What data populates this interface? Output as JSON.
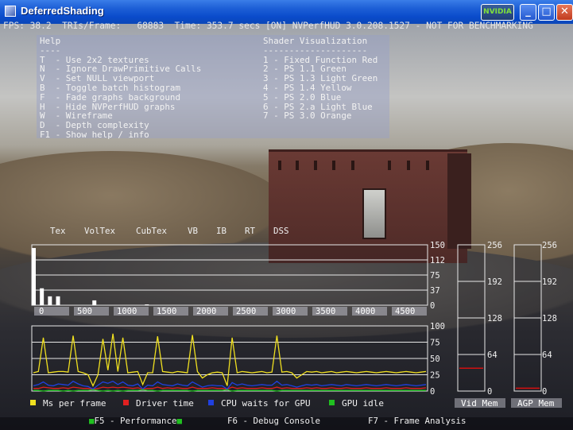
{
  "window": {
    "title": "DeferredShading",
    "nvidia_button": "NVIDIA",
    "minimize_glyph": "_",
    "maximize_glyph": "□",
    "close_glyph": "✕"
  },
  "status_line": "FPS: 38.2  TRIs/Frame:   68883  Time: 353.7 secs [ON] NVPerfHUD 3.0.208.1527 - NOT FOR BENCHMARKING",
  "help": {
    "title": "Help",
    "underline": "----",
    "items": [
      "T  - Use 2x2 textures",
      "N  - Ignore DrawPrimitive Calls",
      "V  - Set NULL viewport",
      "B  - Toggle batch histogram",
      "F  - Fade graphs background",
      "H  - Hide NVPerfHUD graphs",
      "W  - Wireframe",
      "D  - Depth complexity",
      "F1 - Show help / info"
    ]
  },
  "shader_vis": {
    "title": "Shader Visualization",
    "underline": "--------------------",
    "items": [
      "1 - Fixed Function Red",
      "2 - PS 1.1 Green",
      "3 - PS 1.3 Light Green",
      "4 - PS 1.4 Yellow",
      "5 - PS 2.0 Blue",
      "6 - PS 2.a Light Blue",
      "7 - PS 3.0 Orange"
    ]
  },
  "histogram": {
    "tabs": [
      "Tex",
      "VolTex",
      "CubTex",
      "VB",
      "IB",
      "RT",
      "DSS"
    ],
    "x_ticks": [
      "0",
      "500",
      "1000",
      "1500",
      "2000",
      "2500",
      "3000",
      "3500",
      "4000",
      "4500"
    ],
    "y_ticks": [
      "150",
      "112",
      "75",
      "37",
      "0"
    ]
  },
  "perf_graph": {
    "y_ticks": [
      "100",
      "75",
      "50",
      "25",
      "0"
    ],
    "legend": [
      {
        "label": "Ms per frame",
        "color": "#f0e020"
      },
      {
        "label": "Driver time",
        "color": "#e02020"
      },
      {
        "label": "CPU waits for GPU",
        "color": "#2040e0"
      },
      {
        "label": "GPU idle",
        "color": "#20c020"
      }
    ]
  },
  "memory": {
    "vid_label": "Vid Mem",
    "agp_label": "AGP Mem",
    "ticks": [
      "256",
      "192",
      "128",
      "64",
      "0"
    ],
    "vid_used_mb": 40,
    "agp_used_mb": 5,
    "bar_color": "#d01010"
  },
  "footer": {
    "items": [
      "F5 - Performance",
      "F6 - Debug Console",
      "F7 - Frame Analysis"
    ],
    "active_color": "#20c020"
  },
  "chart_data": [
    {
      "type": "bar",
      "title": "",
      "x": [
        0,
        100,
        200,
        300,
        750,
        1400
      ],
      "values": [
        142,
        42,
        22,
        22,
        12,
        2
      ],
      "xlim": [
        0,
        4900
      ],
      "ylim": [
        0,
        150
      ]
    },
    {
      "type": "line",
      "title": "",
      "ylim": [
        0,
        100
      ],
      "series": [
        {
          "name": "Ms per frame",
          "values": [
            28,
            30,
            82,
            28,
            29,
            30,
            30,
            29,
            85,
            30,
            28,
            25,
            8,
            25,
            80,
            32,
            88,
            30,
            82,
            28,
            29,
            30,
            10,
            28,
            28,
            84,
            30,
            29,
            28,
            30,
            29,
            28,
            86,
            30,
            20,
            25,
            28,
            29,
            28,
            8,
            82,
            28,
            30,
            29,
            28,
            29,
            30,
            28,
            29,
            85,
            29,
            30,
            28,
            20,
            25,
            30,
            29,
            30,
            28,
            29,
            30,
            28,
            29,
            30,
            29,
            28,
            29,
            30,
            29,
            28,
            29,
            30,
            29,
            28,
            29,
            30,
            29,
            28,
            29,
            30
          ]
        },
        {
          "name": "Driver time",
          "values": [
            4,
            4,
            6,
            5,
            4,
            4,
            5,
            4,
            6,
            5,
            4,
            4,
            3,
            4,
            6,
            5,
            6,
            5,
            6,
            5,
            4,
            5,
            3,
            4,
            4,
            6,
            4,
            5,
            4,
            5,
            4,
            4,
            6,
            4,
            4,
            4,
            5,
            4,
            4,
            3,
            6,
            4,
            5,
            4,
            4,
            4,
            5,
            4,
            4,
            6,
            4,
            5,
            4,
            4,
            4,
            5,
            4,
            5,
            4,
            4,
            5,
            4,
            4,
            5,
            4,
            4,
            4,
            5,
            4,
            4,
            4,
            5,
            4,
            4,
            4,
            5,
            4,
            4,
            4,
            5
          ]
        },
        {
          "name": "CPU waits for GPU",
          "values": [
            8,
            10,
            14,
            9,
            8,
            11,
            10,
            9,
            15,
            11,
            8,
            7,
            3,
            9,
            14,
            12,
            15,
            10,
            14,
            9,
            8,
            11,
            3,
            9,
            8,
            14,
            10,
            9,
            8,
            11,
            9,
            8,
            14,
            10,
            6,
            8,
            9,
            8,
            8,
            3,
            13,
            9,
            11,
            9,
            8,
            9,
            10,
            9,
            9,
            15,
            9,
            10,
            8,
            6,
            8,
            10,
            9,
            10,
            8,
            9,
            10,
            9,
            8,
            10,
            9,
            8,
            9,
            10,
            9,
            8,
            9,
            10,
            9,
            8,
            9,
            10,
            9,
            8,
            9,
            10
          ]
        },
        {
          "name": "GPU idle",
          "values": [
            1,
            1,
            0,
            1,
            1,
            1,
            0,
            1,
            0,
            1,
            1,
            1,
            2,
            1,
            0,
            1,
            0,
            1,
            0,
            1,
            1,
            1,
            2,
            1,
            1,
            0,
            1,
            1,
            1,
            1,
            1,
            1,
            0,
            1,
            1,
            1,
            1,
            1,
            1,
            2,
            0,
            1,
            1,
            1,
            1,
            1,
            1,
            1,
            1,
            0,
            1,
            1,
            1,
            1,
            1,
            1,
            1,
            1,
            1,
            1,
            1,
            1,
            1,
            1,
            1,
            1,
            1,
            1,
            1,
            1,
            1,
            1,
            1,
            1,
            1,
            1,
            1,
            1,
            1,
            1
          ]
        }
      ]
    },
    {
      "type": "bar",
      "title": "",
      "categories": [
        "Vid Mem",
        "AGP Mem"
      ],
      "values": [
        40,
        5
      ],
      "ylim": [
        0,
        256
      ]
    }
  ]
}
